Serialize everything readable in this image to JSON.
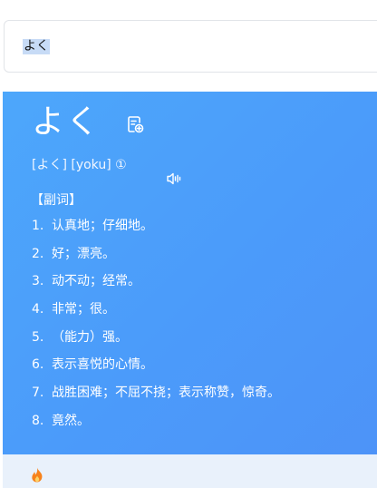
{
  "search": {
    "query": "よく"
  },
  "entry": {
    "headword": "よく",
    "pronunciation": "[よく] [yoku] ①",
    "part_of_speech": "【副词】",
    "definitions": [
      {
        "num": "1.",
        "text": "认真地；仔细地。"
      },
      {
        "num": "2.",
        "text": "好；漂亮。"
      },
      {
        "num": "3.",
        "text": "动不动；经常。"
      },
      {
        "num": "4.",
        "text": "非常；很。"
      },
      {
        "num": "5.",
        "text": "（能力）强。"
      },
      {
        "num": "6.",
        "text": "表示喜悦的心情。"
      },
      {
        "num": "7.",
        "text": "战胜困难；不屈不挠；表示称赞，惊奇。"
      },
      {
        "num": "8.",
        "text": "竟然。"
      }
    ]
  },
  "icons": {
    "wordbook": "add-to-wordbook-icon",
    "audio": "speaker-icon",
    "footer": "fire-icon"
  },
  "colors": {
    "card_gradient_start": "#4da7fb",
    "card_gradient_end": "#4d93f8",
    "footer_bg": "#e9f1fb",
    "fire": "#f7821b"
  }
}
